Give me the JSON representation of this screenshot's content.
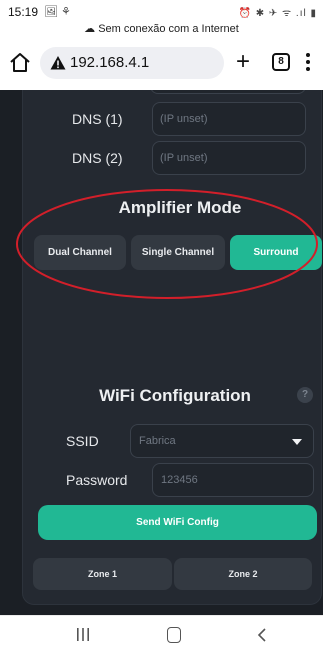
{
  "status_bar": {
    "time": "15:19",
    "left_icons": "🖼 ⚘",
    "right_icons": "⏰ ✱ ✈ ᯤ .ıl ▮",
    "offline_message": "Sem conexão com a Internet"
  },
  "browser": {
    "url": "192.168.4.1",
    "tab_count": "8",
    "icons": [
      "home-icon",
      "warning-icon",
      "new-tab-icon",
      "tabs-icon",
      "menu-icon"
    ]
  },
  "dns": {
    "dns1_label": "DNS (1)",
    "dns1_value": "(IP unset)",
    "dns2_label": "DNS (2)",
    "dns2_value": "(IP unset)"
  },
  "amplifier": {
    "title": "Amplifier Mode",
    "modes": [
      "Dual Channel",
      "Single Channel",
      "Surround"
    ],
    "selected": "Surround",
    "accent_color": "#21b894",
    "highlight_color": "#d21f2a"
  },
  "wifi": {
    "title": "WiFi Configuration",
    "help_symbol": "?",
    "ssid_label": "SSID",
    "ssid_value": "Fabrica",
    "password_label": "Password",
    "password_placeholder": "123456",
    "send_label": "Send WiFi Config"
  },
  "zones": [
    "Zone 1",
    "Zone 2"
  ],
  "nav": {
    "icons": [
      "recents-icon",
      "home-icon",
      "back-icon"
    ]
  }
}
